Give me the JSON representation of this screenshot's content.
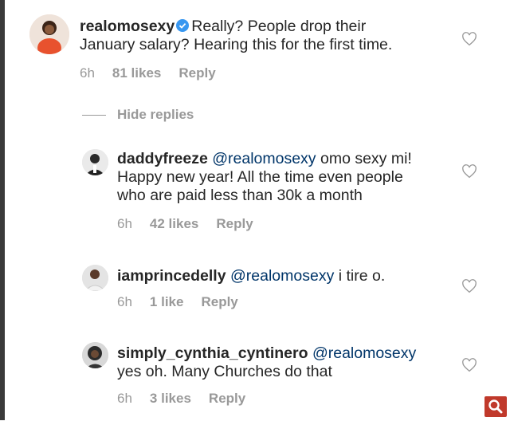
{
  "colors": {
    "text": "#262626",
    "muted": "#999999",
    "mention": "#003569",
    "verified": "#3897f0",
    "search_bg": "#c0392b"
  },
  "comments": [
    {
      "username": "realomosexy",
      "verified": true,
      "text_line1": "Really? People drop their",
      "text_line2": "January salary? Hearing this for the first time.",
      "time": "6h",
      "likes": "81 likes",
      "reply": "Reply"
    }
  ],
  "hide_replies": "Hide replies",
  "replies": [
    {
      "username": "daddyfreeze",
      "mention": "@realomosexy",
      "text_line1_rest": "omo sexy mi!",
      "text_line2": "Happy new year! All the time even people",
      "text_line3": "who are paid less than 30k a month",
      "time": "6h",
      "likes": "42 likes",
      "reply": "Reply"
    },
    {
      "username": "iamprincedelly",
      "mention": "@realomosexy",
      "text_line1_rest": "i tire o.",
      "time": "6h",
      "likes": "1 like",
      "reply": "Reply"
    },
    {
      "username": "simply_cynthia_cyntinero",
      "mention": "@realomosexy",
      "text_line2": "yes oh. Many Churches do that",
      "time": "6h",
      "likes": "3 likes",
      "reply": "Reply"
    }
  ],
  "icons": {
    "like": "heart-outline-icon",
    "verified": "verified-badge-icon",
    "search": "search-icon"
  }
}
